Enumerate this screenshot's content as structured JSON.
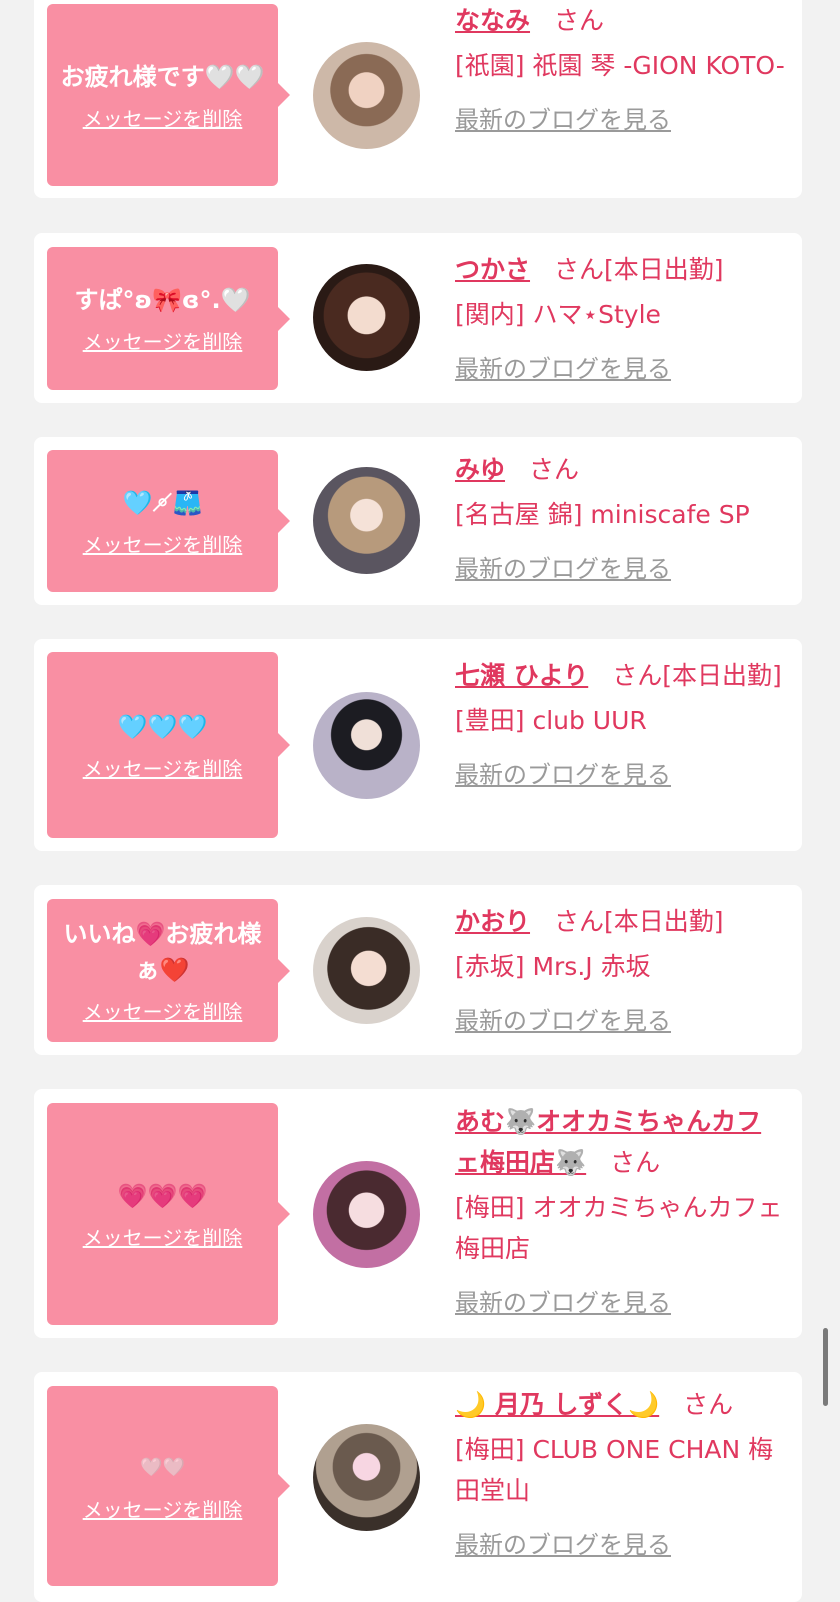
{
  "ui": {
    "delete_label": "メッセージを削除",
    "blog_label": "最新のブログを見る",
    "san_label": "さん"
  },
  "colors": {
    "background": "#f2f2f2",
    "card": "#ffffff",
    "bubble": "#f98fa3",
    "accent": "#e0385f",
    "link_gray": "#9a9a9a"
  },
  "cards": [
    {
      "message": "お疲れ様です🤍🤍",
      "name": "ななみ",
      "status": "",
      "shop": "[祇園] 祇園 琴 -GION KOTO-"
    },
    {
      "message": "すぱ°ʚ🎀ɞ°.🤍",
      "name": "つかさ",
      "status": "[本日出勤]",
      "shop": "[関内] ハマ⋆Style"
    },
    {
      "message": "🩵⚬̸🩳",
      "name": "みゆ",
      "status": "",
      "shop": "[名古屋 錦] miniscafe SP"
    },
    {
      "message": "🩵🩵🩵",
      "name": "七瀬 ひより",
      "status": "[本日出勤]",
      "shop": "[豊田] club UUR"
    },
    {
      "message": "いいね💗お疲れ様ぁ❤️",
      "name": "かおり",
      "status": "[本日出勤]",
      "shop": "[赤坂] Mrs.J 赤坂"
    },
    {
      "message": "💗💗💗",
      "name": "あむ🐺オオカミちゃんカフェ梅田店🐺",
      "status": "",
      "shop": "[梅田] オオカミちゃんカフェ梅田店"
    },
    {
      "message": "🤍🤍",
      "name": "🌙 月乃 しずく🌙",
      "status": "",
      "shop": "[梅田] CLUB ONE CHAN 梅田堂山"
    }
  ]
}
